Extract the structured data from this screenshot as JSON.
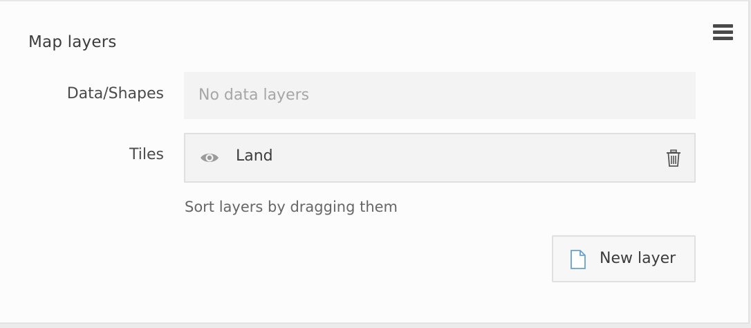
{
  "panel": {
    "title": "Map layers",
    "menu_icon": "hamburger-menu-icon"
  },
  "data_shapes": {
    "label": "Data/Shapes",
    "empty_text": "No data layers"
  },
  "tiles": {
    "label": "Tiles",
    "items": [
      {
        "name": "Land",
        "visibility_icon": "eye-icon",
        "delete_icon": "trash-icon"
      }
    ]
  },
  "hint": "Sort layers by dragging them",
  "new_layer_button": {
    "label": "New layer",
    "icon": "file-icon"
  },
  "colors": {
    "panel_bg": "#fcfcfc",
    "field_bg": "#f3f3f3",
    "text": "#3c3c3c",
    "muted_text": "#a6a6a6",
    "file_icon_accent": "#6aa0cc"
  }
}
